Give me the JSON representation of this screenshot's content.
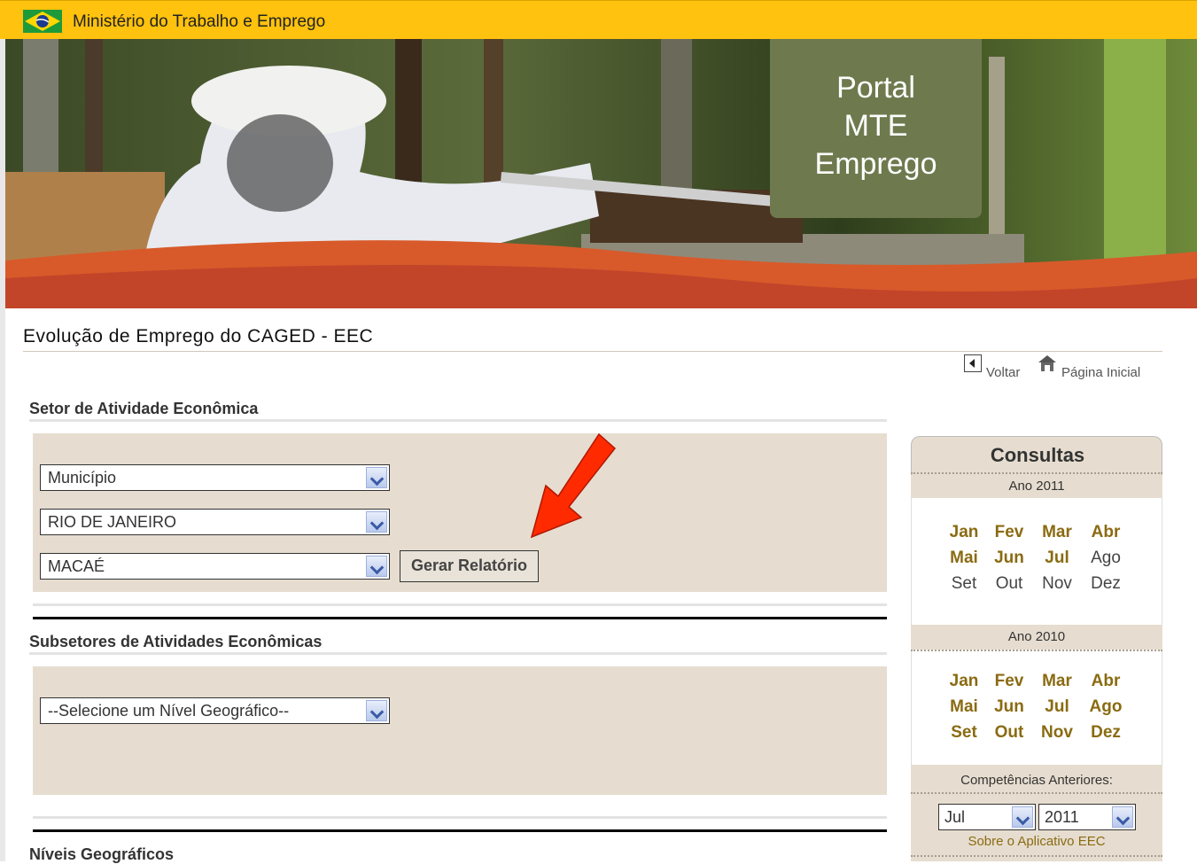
{
  "header": {
    "ministry": "Ministério do Trabalho e Emprego",
    "portal_lines": [
      "Portal",
      "MTE",
      "Emprego"
    ]
  },
  "page": {
    "title": "Evolução de Emprego do CAGED - EEC",
    "nav": {
      "back": "Voltar",
      "home": "Página Inicial"
    }
  },
  "setor": {
    "title": "Setor de Atividade Econômica",
    "level_select": "Município",
    "state_select": "RIO DE JANEIRO",
    "city_select": "MACAÉ",
    "generate_button": "Gerar Relatório"
  },
  "subsetores": {
    "title": "Subsetores de Atividades Econômicas",
    "geo_select": "--Selecione um Nível Geográfico--"
  },
  "niveis": {
    "title": "Níveis Geográficos"
  },
  "sidebar": {
    "title": "Consultas",
    "years": [
      {
        "label": "Ano 2011",
        "months": [
          {
            "name": "Jan",
            "active": true
          },
          {
            "name": "Fev",
            "active": true
          },
          {
            "name": "Mar",
            "active": true
          },
          {
            "name": "Abr",
            "active": true
          },
          {
            "name": "Mai",
            "active": true
          },
          {
            "name": "Jun",
            "active": true
          },
          {
            "name": "Jul",
            "active": true
          },
          {
            "name": "Ago",
            "active": false
          },
          {
            "name": "Set",
            "active": false
          },
          {
            "name": "Out",
            "active": false
          },
          {
            "name": "Nov",
            "active": false
          },
          {
            "name": "Dez",
            "active": false
          }
        ]
      },
      {
        "label": "Ano 2010",
        "months": [
          {
            "name": "Jan",
            "active": true
          },
          {
            "name": "Fev",
            "active": true
          },
          {
            "name": "Mar",
            "active": true
          },
          {
            "name": "Abr",
            "active": true
          },
          {
            "name": "Mai",
            "active": true
          },
          {
            "name": "Jun",
            "active": true
          },
          {
            "name": "Jul",
            "active": true
          },
          {
            "name": "Ago",
            "active": true
          },
          {
            "name": "Set",
            "active": true
          },
          {
            "name": "Out",
            "active": true
          },
          {
            "name": "Nov",
            "active": true
          },
          {
            "name": "Dez",
            "active": true
          }
        ]
      }
    ],
    "previous_label": "Competências Anteriores:",
    "month_select": "Jul",
    "year_select": "2011",
    "about_link": "Sobre o Aplicativo EEC"
  },
  "colors": {
    "topbar": "#ffc20e",
    "panel": "#e6ddd0",
    "month_active": "#8a6b12",
    "annotation_arrow": "#ff2a00"
  }
}
